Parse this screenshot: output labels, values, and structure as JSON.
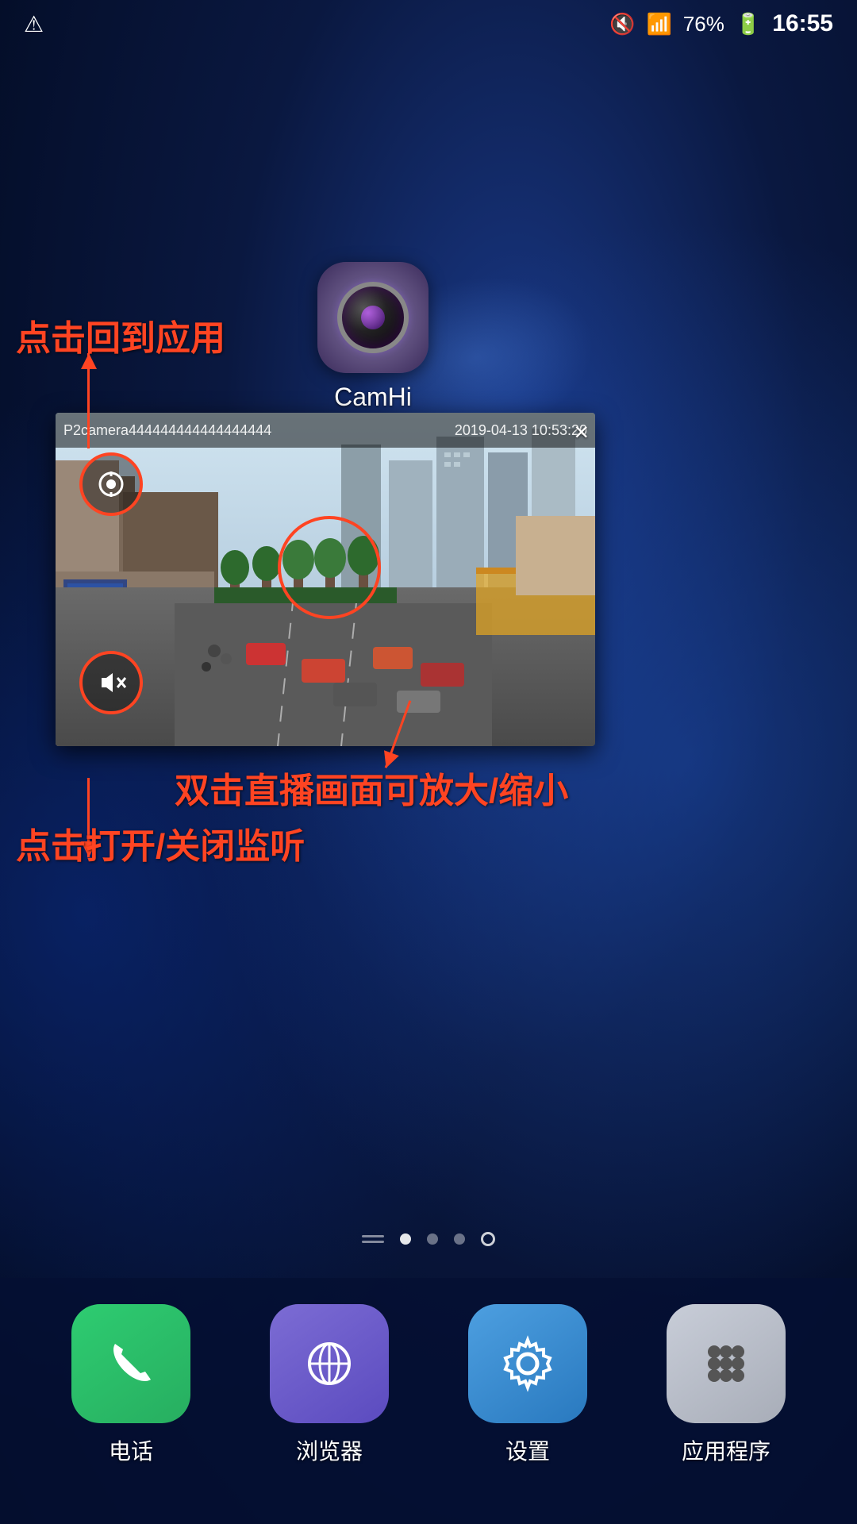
{
  "statusBar": {
    "batteryLevel": "76%",
    "time": "16:55",
    "wifiSignal": "wifi",
    "cellSignal": "cell",
    "mute": "mute",
    "warning": "⚠"
  },
  "camhi": {
    "appName": "CamHi"
  },
  "video": {
    "cameraName": "P2camera444444444444444444",
    "timestamp": "2019-04-13 10:53:20",
    "closeButton": "×"
  },
  "annotations": {
    "returnToApp": "点击回到应用",
    "doubleTap": "双击直播画面可放大/缩小",
    "audioToggle": "点击打开/关闭监听"
  },
  "pageDots": {
    "total": 5,
    "active": 1
  },
  "dock": {
    "items": [
      {
        "id": "phone",
        "label": "电话",
        "icon": "📞"
      },
      {
        "id": "browser",
        "label": "浏览器",
        "icon": "🌐"
      },
      {
        "id": "settings",
        "label": "设置",
        "icon": "⚙️"
      },
      {
        "id": "apps",
        "label": "应用程序",
        "icon": "⠿"
      }
    ]
  }
}
